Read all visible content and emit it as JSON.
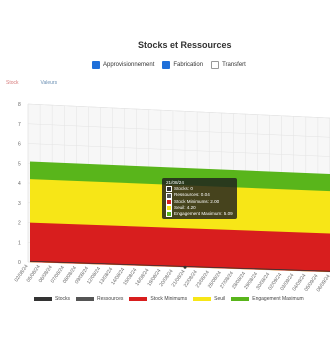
{
  "title": "Stocks et Ressources",
  "checkboxes": [
    {
      "label": "Approvisionnement",
      "checked": true
    },
    {
      "label": "Fabrication",
      "checked": true
    },
    {
      "label": "Transfert",
      "checked": false
    }
  ],
  "tabs": [
    {
      "label": "Stock",
      "active": true
    },
    {
      "label": "Valeurs",
      "active": false
    }
  ],
  "tooltip": {
    "date": "21/08/24",
    "rows": [
      {
        "label": "Stocks: 0",
        "color": "#333333"
      },
      {
        "label": "Ressources: 0.04",
        "color": "#555555"
      },
      {
        "label": "Stock Minimums: 2.00",
        "color": "#d81e1e"
      },
      {
        "label": "Seuil: 4.20",
        "color": "#f7e617"
      },
      {
        "label": "Engagement Maximum: 5.09",
        "color": "#59b51b"
      }
    ]
  },
  "legend": [
    {
      "label": "Stocks",
      "color": "#333333"
    },
    {
      "label": "Ressources",
      "color": "#555555"
    },
    {
      "label": "Stock Minimums",
      "color": "#d81e1e"
    },
    {
      "label": "Seuil",
      "color": "#f7e617"
    },
    {
      "label": "Engagement Maximum",
      "color": "#59b51b"
    }
  ],
  "chart_data": {
    "type": "area",
    "ylim": [
      0,
      8
    ],
    "yticks": [
      0,
      1,
      2,
      3,
      4,
      5,
      6,
      7,
      8
    ],
    "x": [
      "02/08/24",
      "05/08/24",
      "06/08/24",
      "07/08/24",
      "08/08/24",
      "09/08/24",
      "12/08/24",
      "13/08/24",
      "14/08/24",
      "15/08/24",
      "16/08/24",
      "19/08/24",
      "20/08/24",
      "21/08/24",
      "22/08/24",
      "23/08/24",
      "26/08/24",
      "27/08/24",
      "28/08/24",
      "29/08/24",
      "30/08/24",
      "02/09/24",
      "03/09/24",
      "04/09/24",
      "05/09/24",
      "06/09/24"
    ],
    "series": [
      {
        "name": "Stocks",
        "value": 0,
        "color": "#333333"
      },
      {
        "name": "Ressources",
        "value": 0.04,
        "color": "#555555"
      },
      {
        "name": "Stock Minimums",
        "value": 2.0,
        "color": "#d81e1e"
      },
      {
        "name": "Seuil",
        "value": 4.2,
        "color": "#f7e617"
      },
      {
        "name": "Engagement Maximum",
        "value": 5.09,
        "color": "#59b51b"
      }
    ]
  }
}
